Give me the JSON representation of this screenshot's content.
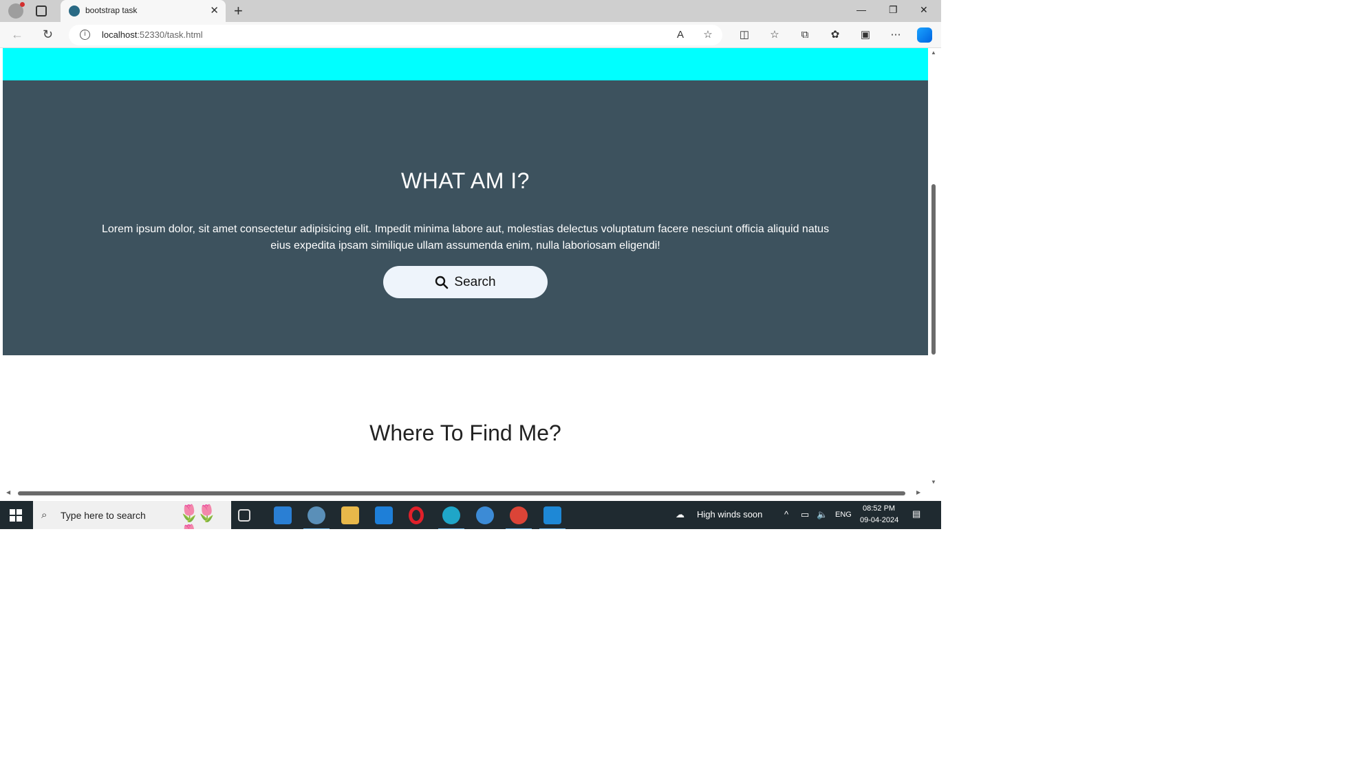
{
  "browser": {
    "tab_title": "bootstrap task",
    "url_host": "localhost",
    "url_path": ":52330/task.html"
  },
  "page": {
    "hero_title": "WHAT AM I?",
    "hero_text": "Lorem ipsum dolor, sit amet consectetur adipisicing elit. Impedit minima labore aut, molestias delectus voluptatum facere nesciunt officia aliquid natus eius expedita ipsam similique ullam assumenda enim, nulla laboriosam eligendi!",
    "search_button_label": "Search",
    "section2_title": "Where To Find Me?"
  },
  "taskbar": {
    "search_placeholder": "Type here to search",
    "weather": "High winds soon",
    "language": "ENG",
    "time": "08:52 PM",
    "date": "09-04-2024"
  },
  "colors": {
    "topbar": "#00ffff",
    "hero_bg": "#3d525e",
    "button_bg": "#eef4fb"
  }
}
